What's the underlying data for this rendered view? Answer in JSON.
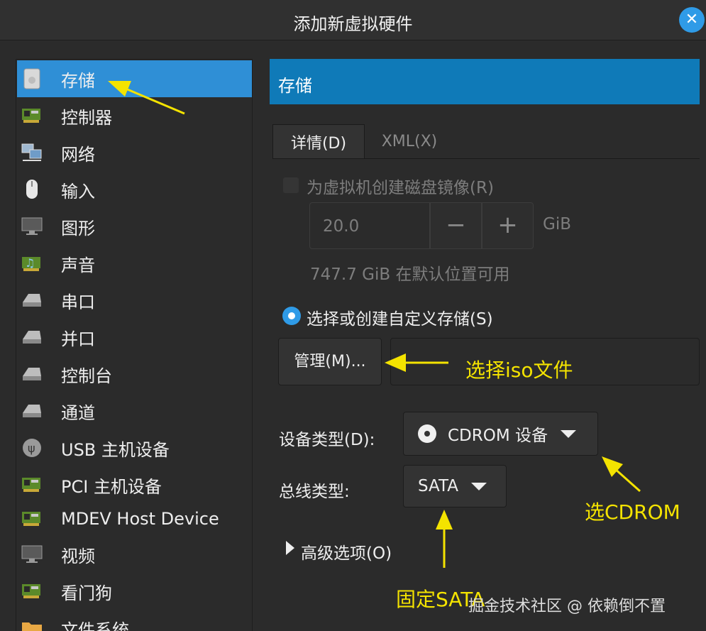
{
  "window": {
    "title": "添加新虚拟硬件",
    "close_symbol": "✕"
  },
  "sidebar": {
    "items": [
      {
        "label": "存储",
        "icon": "disk-icon"
      },
      {
        "label": "控制器",
        "icon": "pci-card-icon"
      },
      {
        "label": "网络",
        "icon": "network-icon"
      },
      {
        "label": "输入",
        "icon": "mouse-icon"
      },
      {
        "label": "图形",
        "icon": "monitor-icon"
      },
      {
        "label": "声音",
        "icon": "sound-card-icon"
      },
      {
        "label": "串口",
        "icon": "serial-port-icon"
      },
      {
        "label": "并口",
        "icon": "parallel-port-icon"
      },
      {
        "label": "控制台",
        "icon": "console-icon"
      },
      {
        "label": "通道",
        "icon": "channel-icon"
      },
      {
        "label": "USB 主机设备",
        "icon": "usb-icon"
      },
      {
        "label": "PCI 主机设备",
        "icon": "pci-card-icon"
      },
      {
        "label": "MDEV Host Device",
        "icon": "pci-card-icon"
      },
      {
        "label": "视频",
        "icon": "monitor-icon"
      },
      {
        "label": "看门狗",
        "icon": "pci-card-icon"
      },
      {
        "label": "文件系统",
        "icon": "folder-icon"
      }
    ],
    "selected_index": 0
  },
  "main": {
    "header": "存储",
    "tabs": [
      {
        "label": "详情(D)",
        "active": true
      },
      {
        "label": "XML(X)",
        "active": false
      }
    ],
    "create_disk": {
      "label": "为虚拟机创建磁盘镜像(R)",
      "checked": false,
      "size_value": "20.0",
      "minus": "−",
      "plus": "+",
      "unit": "GiB",
      "available": "747.7 GiB 在默认位置可用"
    },
    "custom_storage": {
      "label": "选择或创建自定义存储(S)",
      "selected": true,
      "manage_button": "管理(M)...",
      "path_value": ""
    },
    "device_type": {
      "label": "设备类型(D):",
      "value": "CDROM 设备"
    },
    "bus_type": {
      "label": "总线类型:",
      "value": "SATA"
    },
    "advanced": {
      "label": "高级选项(O)"
    }
  },
  "annotations": {
    "iso": "选择iso文件",
    "cdrom": "选CDROM",
    "sata": "固定SATA",
    "color": "#f4e300"
  },
  "watermark": "掘金技术社区 @ 依赖倒不置",
  "colors": {
    "accent": "#2f8fd6",
    "header": "#0f7ab8",
    "background": "#2b2b2b"
  }
}
